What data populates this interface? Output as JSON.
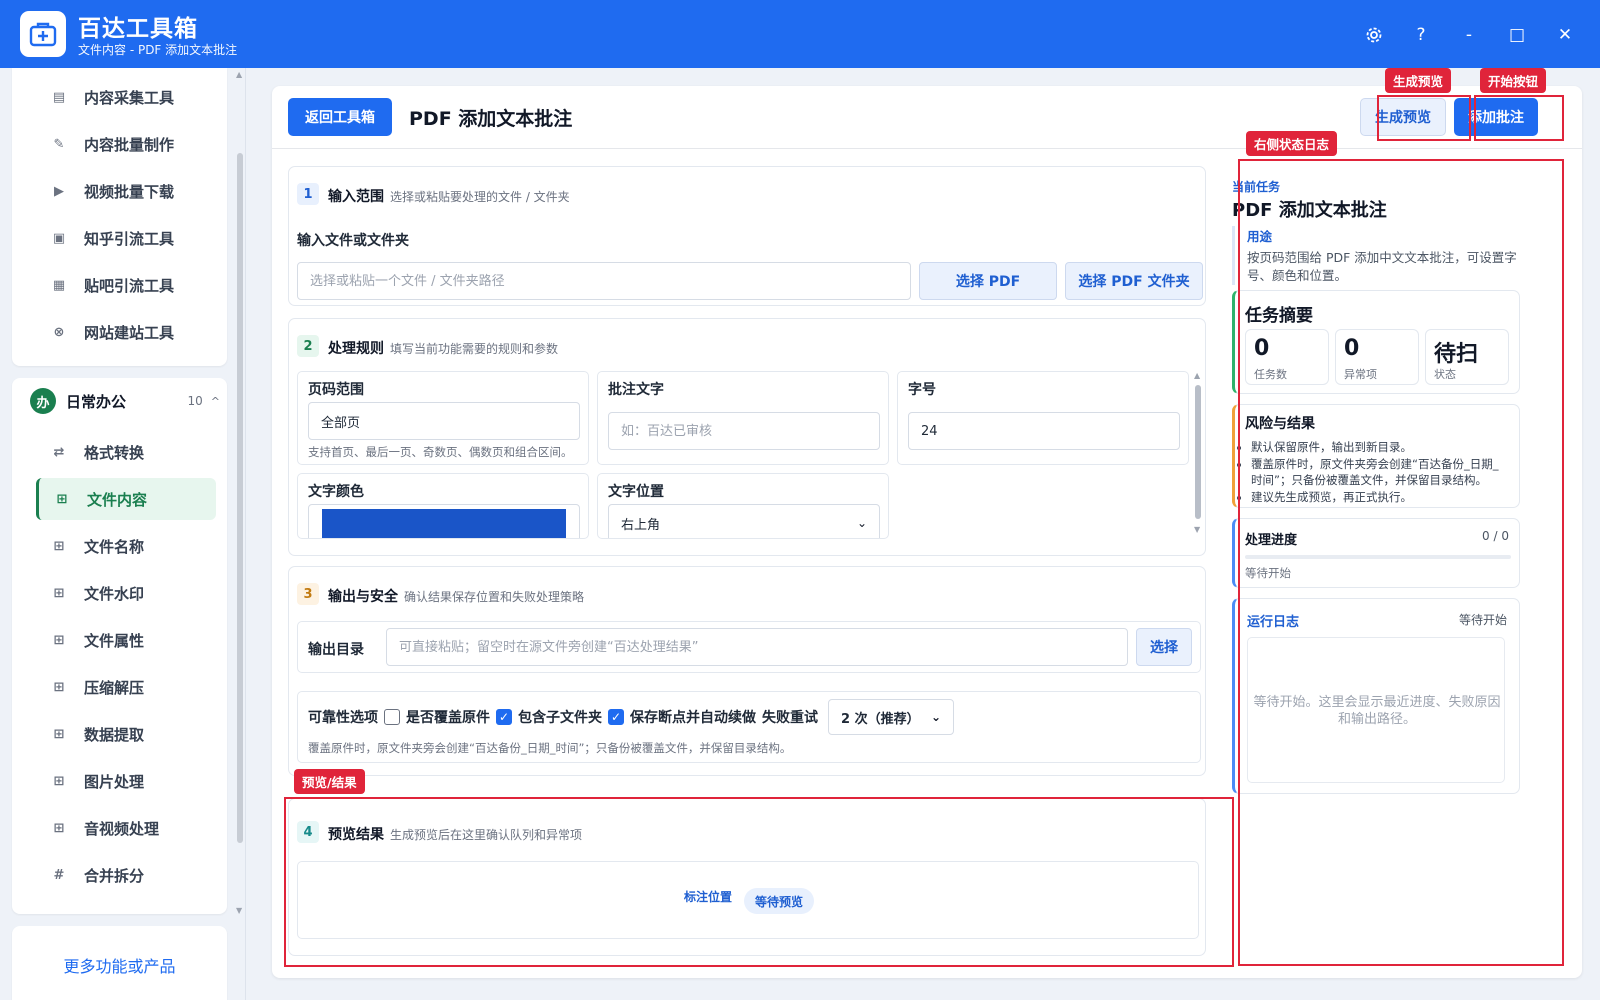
{
  "app": {
    "title": "百达工具箱",
    "subtitle": "文件内容 - PDF 添加文本批注"
  },
  "window_controls": {
    "settings_icon": "gear-icon",
    "help_label": "?",
    "minimize_label": "-",
    "maximize_label": "□",
    "close_label": "✕"
  },
  "sidebar": {
    "top_items": [
      {
        "label": "内容采集工具",
        "icon": "document-icon"
      },
      {
        "label": "内容批量制作",
        "icon": "pen-icon"
      },
      {
        "label": "视频批量下载",
        "icon": "video-icon"
      },
      {
        "label": "知乎引流工具",
        "icon": "zhihu-icon"
      },
      {
        "label": "贴吧引流工具",
        "icon": "tieba-icon"
      },
      {
        "label": "网站建站工具",
        "icon": "globe-icon"
      }
    ],
    "group": {
      "badge": "办",
      "name": "日常办公",
      "count": "10",
      "caret": "^"
    },
    "group_items": [
      {
        "label": "格式转换",
        "icon": "swap-icon"
      },
      {
        "label": "文件内容",
        "icon": "grid-icon",
        "active": true
      },
      {
        "label": "文件名称",
        "icon": "grid-icon"
      },
      {
        "label": "文件水印",
        "icon": "grid-icon"
      },
      {
        "label": "文件属性",
        "icon": "grid-icon"
      },
      {
        "label": "压缩解压",
        "icon": "grid-icon"
      },
      {
        "label": "数据提取",
        "icon": "grid-icon"
      },
      {
        "label": "图片处理",
        "icon": "grid-icon"
      },
      {
        "label": "音视频处理",
        "icon": "grid-icon"
      },
      {
        "label": "合并拆分",
        "icon": "hash-icon"
      }
    ],
    "more_label": "更多功能或产品"
  },
  "header": {
    "back_label": "返回工具箱",
    "page_title": "PDF 添加文本批注",
    "preview_label": "生成预览",
    "start_label": "添加批注"
  },
  "sections": {
    "s1": {
      "num": "1",
      "title": "输入范围",
      "desc": "选择或粘贴要处理的文件 / 文件夹",
      "field_label": "输入文件或文件夹",
      "input_placeholder": "选择或粘贴一个文件 / 文件夹路径",
      "pick_pdf": "选择 PDF",
      "pick_folder": "选择 PDF 文件夹"
    },
    "s2": {
      "num": "2",
      "title": "处理规则",
      "desc": "填写当前功能需要的规则和参数",
      "page_range_label": "页码范围",
      "page_range_value": "全部页",
      "page_range_hint": "支持首页、最后一页、奇数页、偶数页和组合区间。",
      "note_text_label": "批注文字",
      "note_text_placeholder": "如：百达已审核",
      "font_size_label": "字号",
      "font_size_value": "24",
      "color_label": "文字颜色",
      "color_value": "#1a55c8",
      "position_label": "文字位置",
      "position_value": "右上角"
    },
    "s3": {
      "num": "3",
      "title": "输出与安全",
      "desc": "确认结果保存位置和失败处理策略",
      "output_label": "输出目录",
      "output_placeholder": "可直接粘贴；留空时在源文件旁创建“百达处理结果”",
      "output_btn": "选择",
      "reliability_label": "可靠性选项",
      "overwrite_label": "是否覆盖原件",
      "overwrite_checked": false,
      "subfolder_label": "包含子文件夹",
      "subfolder_checked": true,
      "resume_label": "保存断点并自动续做",
      "resume_checked": true,
      "retry_label": "失败重试",
      "retry_value": "2 次（推荐）",
      "note": "覆盖原件时，原文件夹旁会创建“百达备份_日期_时间”；只备份被覆盖文件，并保留目录结构。"
    },
    "s4": {
      "num": "4",
      "title": "预览结果",
      "desc": "生成预览后在这里确认队列和异常项",
      "col_label": "标注位置",
      "status_pill": "等待预览"
    }
  },
  "right_panel": {
    "eyebrow": "当前任务",
    "title": "PDF 添加文本批注",
    "usage_heading": "用途",
    "usage_text": "按页码范围给 PDF 添加中文文本批注，可设置字号、颜色和位置。",
    "summary_title": "任务摘要",
    "stats": [
      {
        "value": "0",
        "label": "任务数"
      },
      {
        "value": "0",
        "label": "异常项"
      },
      {
        "value": "待扫",
        "label": "状态"
      }
    ],
    "risk_title": "风险与结果",
    "risks": [
      "默认保留原件，输出到新目录。",
      "覆盖原件时，原文件夹旁会创建“百达备份_日期_时间”；只备份被覆盖文件，并保留目录结构。",
      "建议先生成预览，再正式执行。"
    ],
    "progress_title": "处理进度",
    "progress_count": "0 / 0",
    "progress_fraction": 0,
    "progress_status": "等待开始",
    "log_title": "运行日志",
    "log_status": "等待开始",
    "log_placeholder": "等待开始。这里会显示最近进度、失败原因和输出路径。"
  },
  "annotations": {
    "preview_tag": "生成预览",
    "start_tag": "开始按钮",
    "log_tag": "右侧状态日志",
    "result_tag": "预览/结果"
  }
}
